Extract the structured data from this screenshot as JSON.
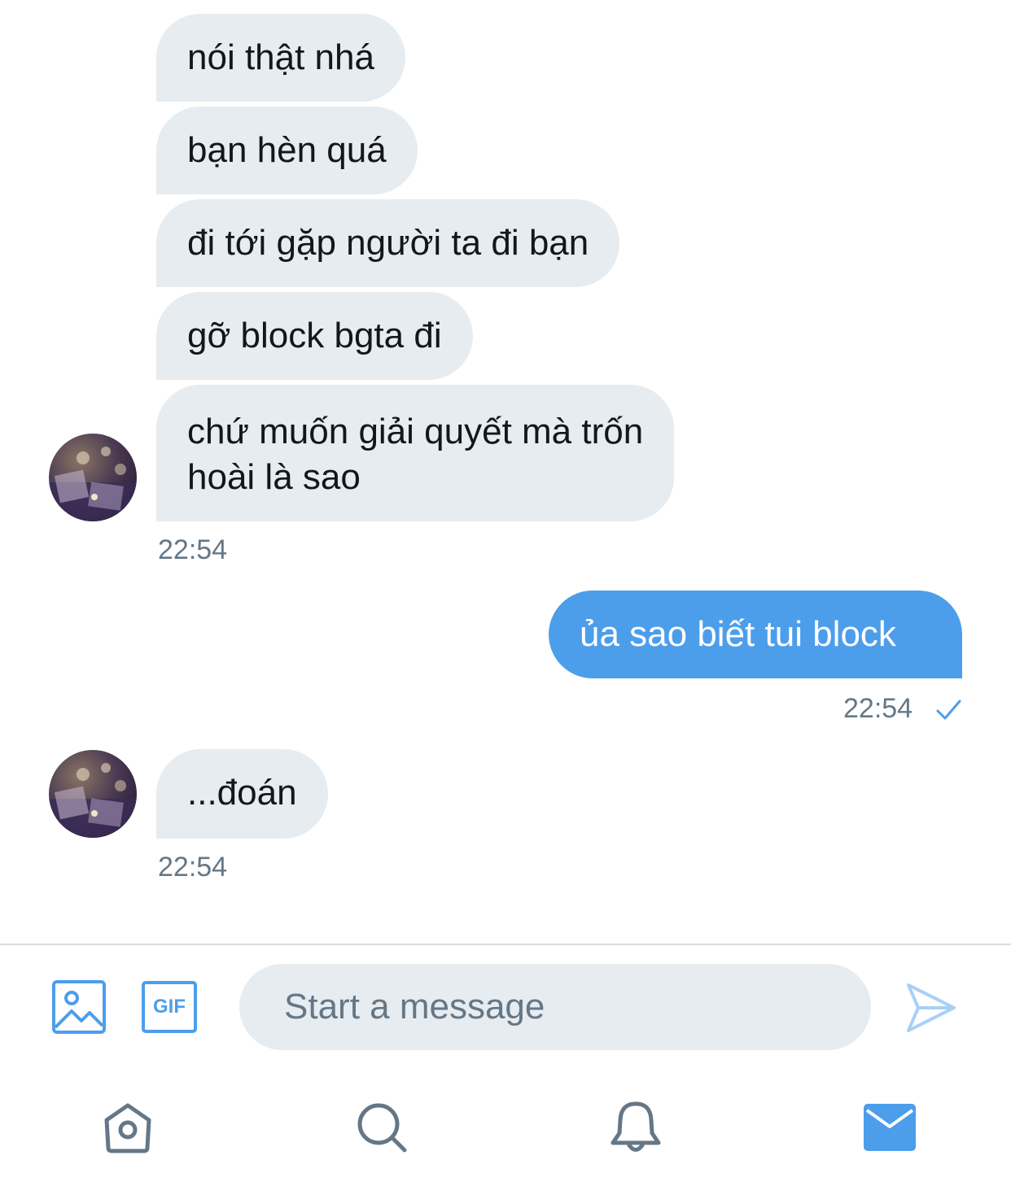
{
  "messages": [
    {
      "text": "nói thật nhá"
    },
    {
      "text": "bạn hèn quá"
    },
    {
      "text": "đi tới gặp người ta đi bạn"
    },
    {
      "text": "gỡ block bgta đi"
    },
    {
      "text": "chứ muốn giải quyết mà trốn",
      "text2": "hoài là sao"
    },
    {
      "text": "ủa sao biết tui block"
    },
    {
      "text": "...đoán"
    }
  ],
  "timestamps": {
    "group1": "22:54",
    "sent": "22:54",
    "group2": "22:54"
  },
  "composer": {
    "placeholder": "Start a message"
  },
  "toolbar": {
    "gif_label": "GIF"
  },
  "icons": {
    "media": "image-icon",
    "gif": "gif-icon",
    "send": "send-icon",
    "home": "home-icon",
    "search": "search-icon",
    "notifications": "bell-icon",
    "messages": "mail-icon",
    "read_receipt": "checkmark-icon"
  },
  "colors": {
    "accent": "#4c9eeb",
    "incoming_bubble": "#e6ecf0",
    "muted_text": "#657786",
    "nav_icon": "#657786"
  }
}
